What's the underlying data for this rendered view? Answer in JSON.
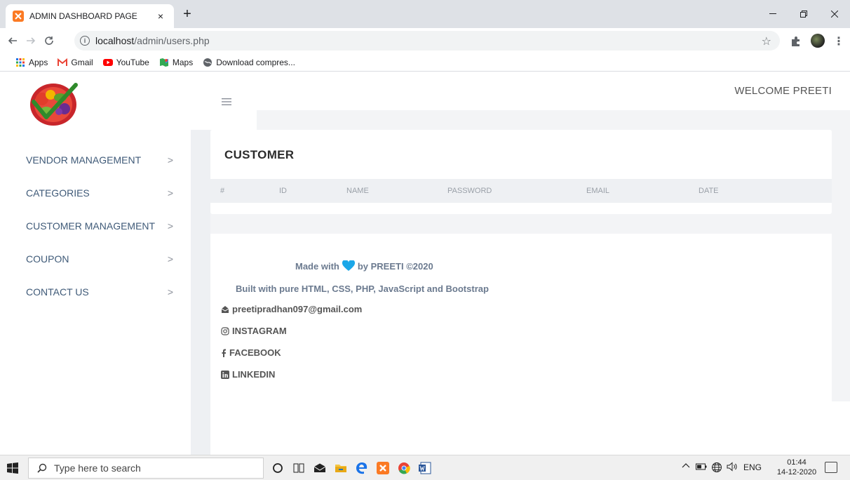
{
  "browser": {
    "tab_title": "ADMIN DASHBOARD PAGE",
    "tab_close": "×",
    "new_tab": "+",
    "url_host": "localhost",
    "url_path": "/admin/users.php",
    "bookmarks": [
      "Apps",
      "Gmail",
      "YouTube",
      "Maps",
      "Download compres..."
    ]
  },
  "header": {
    "welcome": "WELCOME PREETI"
  },
  "sidebar": {
    "items": [
      {
        "label": "VENDOR MANAGEMENT"
      },
      {
        "label": "CATEGORIES"
      },
      {
        "label": "CUSTOMER MANAGEMENT"
      },
      {
        "label": "COUPON"
      },
      {
        "label": "CONTACT US"
      }
    ],
    "chevron": ">"
  },
  "main": {
    "title": "CUSTOMER",
    "columns": [
      "#",
      "ID",
      "NAME",
      "PASSWORD",
      "EMAIL",
      "DATE"
    ]
  },
  "footer": {
    "made_with_prefix": "Made with",
    "made_with_suffix": "by PREETI ©2020",
    "built_with": "Built with pure HTML, CSS, PHP, JavaScript and Bootstrap",
    "email": "preetipradhan097@gmail.com",
    "instagram": "INSTAGRAM",
    "facebook": "FACEBOOK",
    "linkedin": "LINKEDIN",
    "heart_color": "#1ba7e8"
  },
  "taskbar": {
    "search_placeholder": "Type here to search",
    "lang": "ENG",
    "time": "01:44",
    "date": "14-12-2020"
  }
}
